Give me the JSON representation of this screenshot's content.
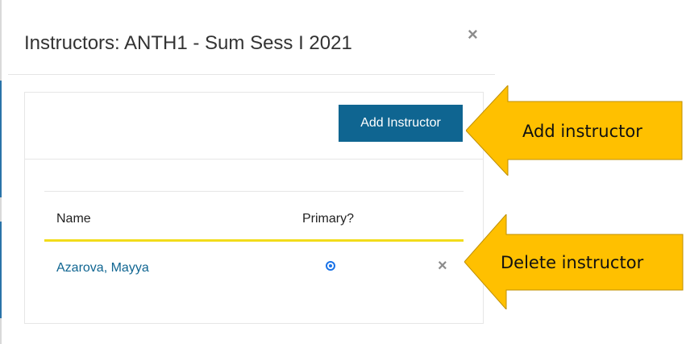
{
  "modal": {
    "title": "Instructors: ANTH1 - Sum Sess I 2021",
    "close_icon": "close-icon"
  },
  "toolbar": {
    "add_label": "Add Instructor"
  },
  "table": {
    "columns": [
      "Name",
      "Primary?"
    ],
    "rows": [
      {
        "name": "Azarova, Mayya",
        "primary": true,
        "delete_icon": "close-icon"
      }
    ]
  },
  "callouts": [
    {
      "label": "Add instructor"
    },
    {
      "label": "Delete instructor"
    }
  ],
  "colors": {
    "accent": "#0f6591",
    "header_rule": "#f2dc1a",
    "callout": "#ffc000",
    "radio": "#1a73e8"
  }
}
